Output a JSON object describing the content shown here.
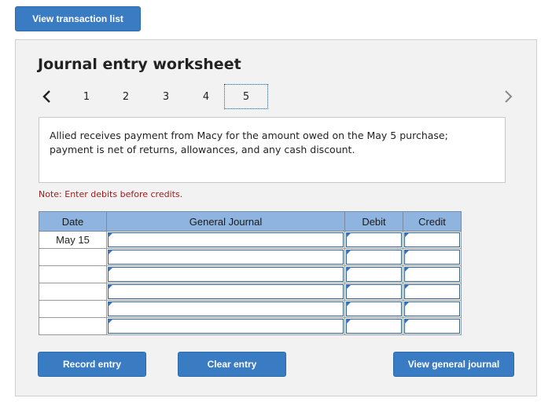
{
  "top_button": "View transaction list",
  "title": "Journal entry worksheet",
  "pages": [
    "1",
    "2",
    "3",
    "4",
    "5"
  ],
  "active_page": "5",
  "description": "Allied receives payment from Macy for the amount owed on the May 5 purchase; payment is net of returns, allowances, and any cash discount.",
  "note": "Note: Enter debits before credits.",
  "table": {
    "headers": [
      "Date",
      "General Journal",
      "Debit",
      "Credit"
    ],
    "rows": [
      {
        "date": "May 15",
        "account": "",
        "debit": "",
        "credit": ""
      },
      {
        "date": "",
        "account": "",
        "debit": "",
        "credit": ""
      },
      {
        "date": "",
        "account": "",
        "debit": "",
        "credit": ""
      },
      {
        "date": "",
        "account": "",
        "debit": "",
        "credit": ""
      },
      {
        "date": "",
        "account": "",
        "debit": "",
        "credit": ""
      },
      {
        "date": "",
        "account": "",
        "debit": "",
        "credit": ""
      }
    ]
  },
  "buttons": {
    "record": "Record entry",
    "clear": "Clear entry",
    "view_journal": "View general journal"
  },
  "colors": {
    "button": "#3a7cc3",
    "header": "#8fb4e0",
    "note": "#a01a1a"
  },
  "icons": {
    "prev": "chevron-left-icon",
    "next": "chevron-right-icon",
    "cell_marker": "triangle-marker-icon"
  }
}
